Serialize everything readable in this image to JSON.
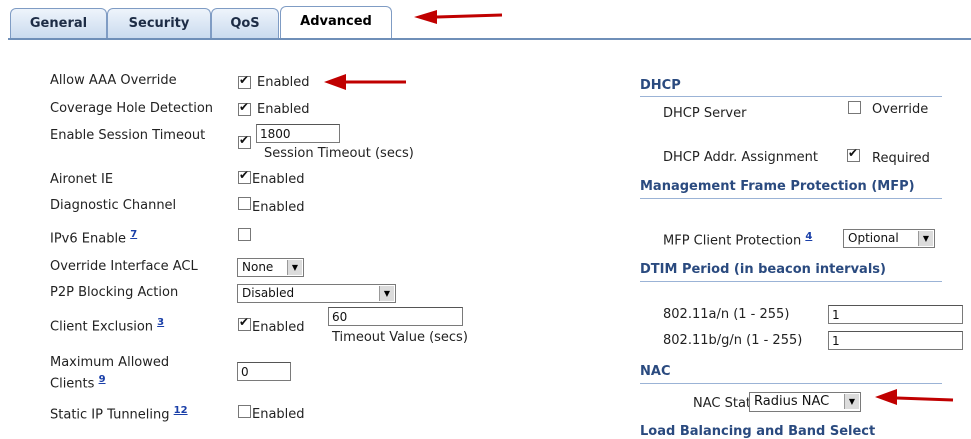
{
  "tabs": [
    {
      "label": "General"
    },
    {
      "label": "Security"
    },
    {
      "label": "QoS"
    },
    {
      "label": "Advanced"
    }
  ],
  "left": {
    "aaa_override": {
      "label": "Allow AAA Override",
      "value": "Enabled"
    },
    "coverage_hole": {
      "label": "Coverage Hole Detection",
      "value": "Enabled"
    },
    "session_timeout": {
      "label": "Enable Session Timeout",
      "input_value": "1800",
      "sub_label": "Session Timeout (secs)"
    },
    "aironet_ie": {
      "label": "Aironet IE",
      "value": "Enabled"
    },
    "diagnostic": {
      "label": "Diagnostic Channel",
      "value": "Enabled"
    },
    "ipv6": {
      "label": "IPv6 Enable",
      "help": "7"
    },
    "override_acl": {
      "label": "Override Interface ACL",
      "selected": "None"
    },
    "p2p": {
      "label": "P2P Blocking Action",
      "selected": "Disabled"
    },
    "client_exclusion": {
      "label": "Client Exclusion",
      "help": "3",
      "value": "Enabled",
      "input_value": "60",
      "sub_label": "Timeout Value (secs)"
    },
    "max_clients": {
      "label_line1": "Maximum Allowed",
      "label_line2": "Clients",
      "help": "9",
      "input_value": "0"
    },
    "static_ip": {
      "label": "Static IP Tunneling",
      "help": "12",
      "value": "Enabled"
    }
  },
  "right": {
    "dhcp": {
      "heading": "DHCP",
      "server_label": "DHCP Server",
      "server_value": "Override",
      "assign_label": "DHCP Addr. Assignment",
      "assign_value": "Required"
    },
    "mfp": {
      "heading": "Management Frame Protection (MFP)",
      "label": "MFP Client Protection",
      "help": "4",
      "selected": "Optional"
    },
    "dtim": {
      "heading": "DTIM Period (in beacon intervals)",
      "a_label": "802.11a/n (1 - 255)",
      "a_value": "1",
      "bg_label": "802.11b/g/n (1 - 255)",
      "bg_value": "1"
    },
    "nac": {
      "heading": "NAC",
      "label": "NAC State",
      "selected": "Radius NAC"
    },
    "load_balancing": {
      "heading": "Load Balancing and Band Select"
    }
  },
  "colors": {
    "accent": "#2a4a7f",
    "arrow": "#c00000"
  }
}
